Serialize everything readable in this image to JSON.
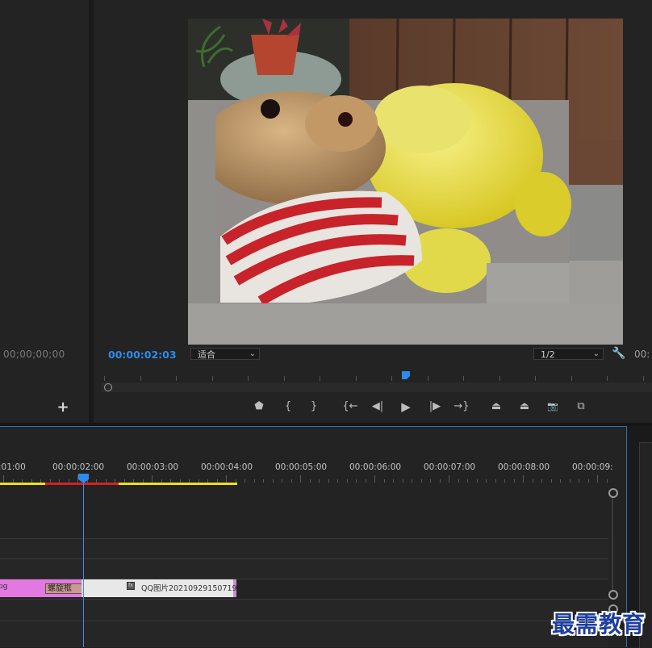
{
  "source_monitor": {
    "timecode": "00;00;00;00",
    "add_button_label": "+"
  },
  "program_monitor": {
    "menu_dots": "...",
    "timecode": "00:00:02:03",
    "fit_dropdown": {
      "selected": "适合"
    },
    "resolution_dropdown": {
      "selected": "1/2"
    },
    "right_timecode": "00:",
    "preview_image": "teddy bear in red-white striped sweater with yellow plush toy on stone, overlaid on potted plant and wooden fence"
  },
  "transport_controls": [
    {
      "name": "add-marker-button",
      "icon": "marker-icon",
      "glyph": "⬟"
    },
    {
      "name": "mark-in-button",
      "icon": "mark-in-icon",
      "glyph": "{"
    },
    {
      "name": "mark-out-button",
      "icon": "mark-out-icon",
      "glyph": "}"
    },
    {
      "name": "go-to-in-button",
      "icon": "go-to-in-icon",
      "glyph": "{←"
    },
    {
      "name": "step-back-button",
      "icon": "step-back-icon",
      "glyph": "◀|"
    },
    {
      "name": "play-button",
      "icon": "play-icon",
      "glyph": "▶"
    },
    {
      "name": "step-forward-button",
      "icon": "step-forward-icon",
      "glyph": "|▶"
    },
    {
      "name": "go-to-out-button",
      "icon": "go-to-out-icon",
      "glyph": "→}"
    },
    {
      "name": "lift-button",
      "icon": "lift-icon",
      "glyph": "⏏"
    },
    {
      "name": "extract-button",
      "icon": "extract-icon",
      "glyph": "⏏"
    },
    {
      "name": "export-frame-button",
      "icon": "camera-icon",
      "glyph": "📷"
    },
    {
      "name": "compare-view-button",
      "icon": "compare-icon",
      "glyph": "⧉"
    }
  ],
  "timeline": {
    "ruler_labels": [
      ":01:00",
      "00:00:02:00",
      "00:00:03:00",
      "00:00:04:00",
      "00:00:05:00",
      "00:00:06:00",
      "00:00:07:00",
      "00:00:08:00",
      "00:00:09:"
    ],
    "clips": {
      "first_clip_label": "pg",
      "effect_label": "螺旋框",
      "fx_badge": "fx",
      "second_clip_label": "QQ图片20210929150719."
    }
  },
  "watermark": "最需教育",
  "colors": {
    "accent_blue": "#2d8ceb",
    "clip_pink": "#e279e0",
    "work_area_yellow": "#e8e026",
    "work_area_red": "#d62020",
    "panel_bg": "#232323"
  }
}
